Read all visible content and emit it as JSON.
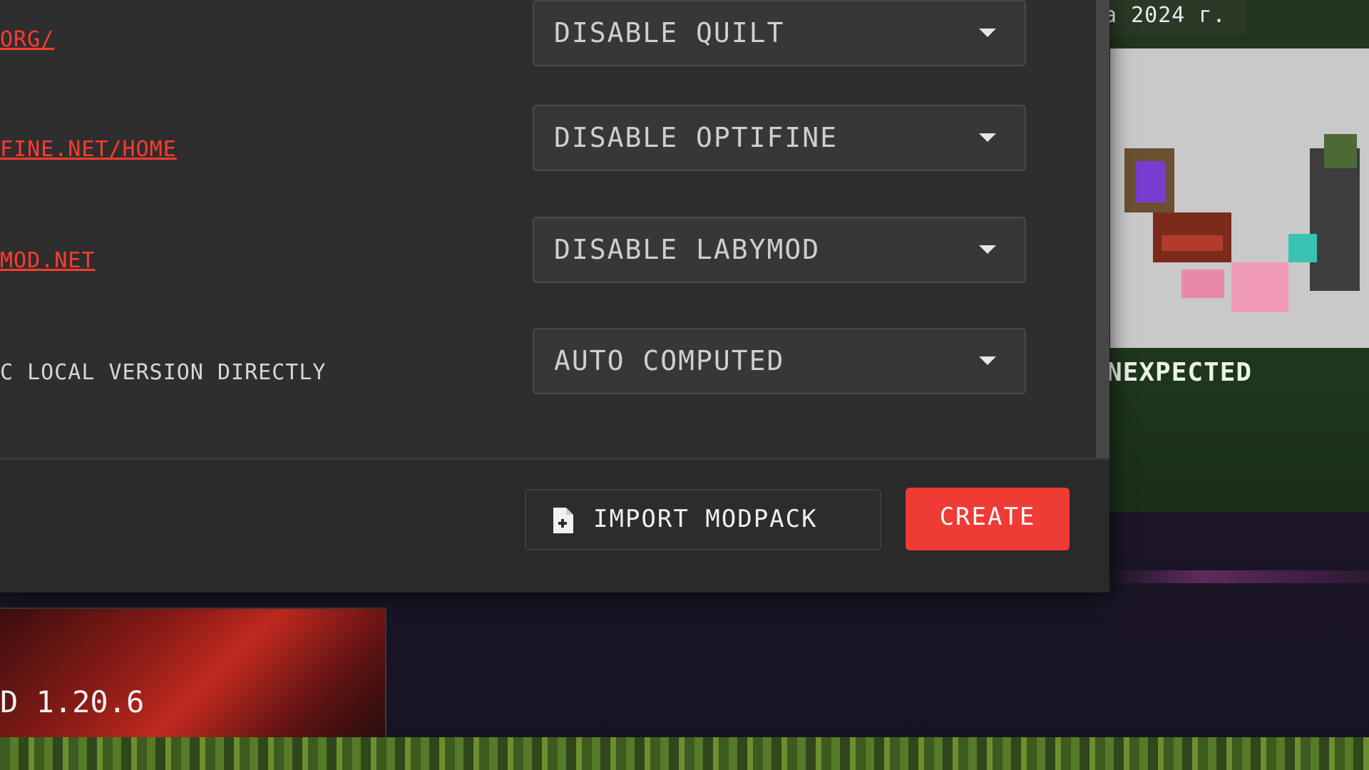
{
  "background": {
    "news": {
      "date_text": "a 2024 г.",
      "title": "NEXPECTED"
    },
    "version_card": {
      "version_text": "D 1.20.6"
    }
  },
  "modal": {
    "rows": [
      {
        "label": "ORG/",
        "type": "link"
      },
      {
        "label": "FINE.NET/HOME",
        "type": "link"
      },
      {
        "label": "MOD.NET",
        "type": "link"
      },
      {
        "label": "C LOCAL VERSION DIRECTLY",
        "type": "text"
      }
    ],
    "selects": [
      {
        "value": "DISABLE QUILT"
      },
      {
        "value": "DISABLE OPTIFINE"
      },
      {
        "value": "DISABLE LABYMOD"
      },
      {
        "value": "AUTO COMPUTED"
      }
    ],
    "footer": {
      "import_label": "IMPORT MODPACK",
      "create_label": "CREATE"
    }
  },
  "colors": {
    "accent": "#ef3b35",
    "link": "#ff3b30",
    "modal_bg": "#2e2e2e"
  }
}
